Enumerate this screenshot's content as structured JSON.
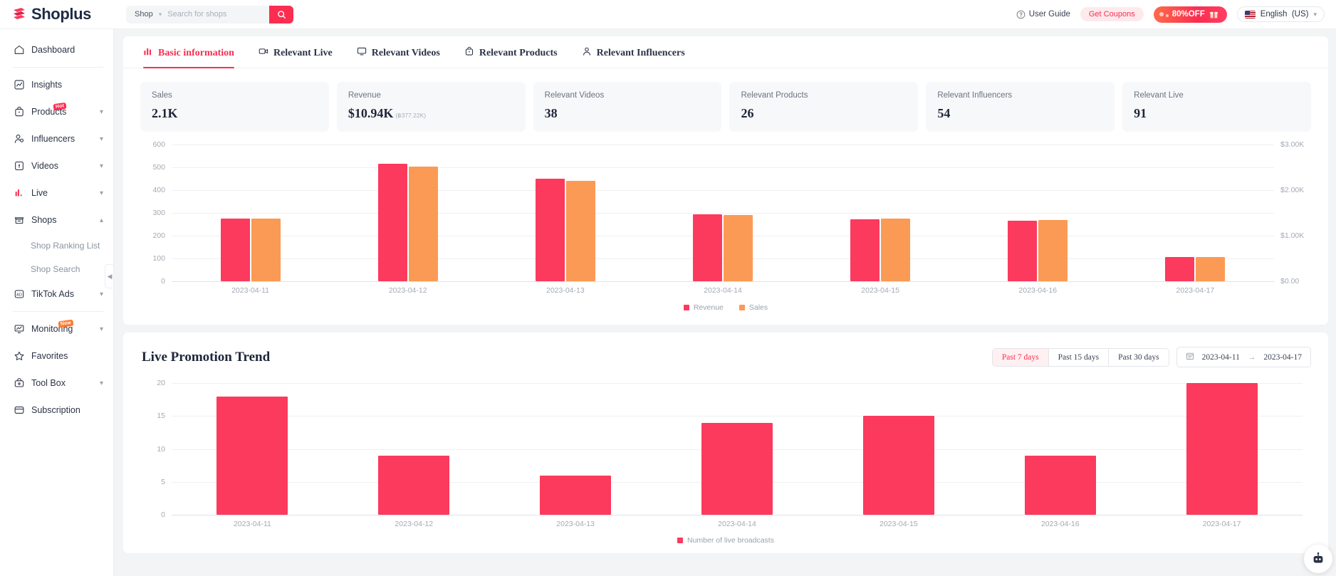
{
  "app": {
    "brand": "Shoplus"
  },
  "search": {
    "scope": "Shop",
    "placeholder": "Search for shops",
    "value": ""
  },
  "header": {
    "user_guide": "User Guide",
    "get_coupons": "Get Coupons",
    "promo": "80%OFF",
    "language": "English  (US)"
  },
  "sidebar": {
    "items": [
      {
        "label": "Dashboard",
        "icon": "home-icon",
        "expandable": false,
        "badge": ""
      },
      {
        "label": "Insights",
        "icon": "insights-icon",
        "expandable": false,
        "badge": ""
      },
      {
        "label": "Products",
        "icon": "products-icon",
        "expandable": true,
        "badge": "Hot"
      },
      {
        "label": "Influencers",
        "icon": "influencers-icon",
        "expandable": true,
        "badge": ""
      },
      {
        "label": "Videos",
        "icon": "videos-icon",
        "expandable": true,
        "badge": ""
      },
      {
        "label": "Live",
        "icon": "live-icon",
        "expandable": true,
        "badge": ""
      },
      {
        "label": "Shops",
        "icon": "shops-icon",
        "expandable": true,
        "badge": ""
      },
      {
        "label": "TikTok Ads",
        "icon": "ads-icon",
        "expandable": true,
        "badge": ""
      },
      {
        "label": "Monitoring",
        "icon": "monitoring-icon",
        "expandable": true,
        "badge": "New"
      },
      {
        "label": "Favorites",
        "icon": "star-icon",
        "expandable": false,
        "badge": ""
      },
      {
        "label": "Tool Box",
        "icon": "toolbox-icon",
        "expandable": true,
        "badge": ""
      },
      {
        "label": "Subscription",
        "icon": "subscription-icon",
        "expandable": false,
        "badge": ""
      }
    ],
    "shops_children": [
      "Shop Ranking List",
      "Shop Search"
    ]
  },
  "tabs": [
    {
      "label": "Basic information",
      "icon": "bar-chart-icon",
      "active": true
    },
    {
      "label": "Relevant Live",
      "icon": "video-camera-icon",
      "active": false
    },
    {
      "label": "Relevant Videos",
      "icon": "monitor-icon",
      "active": false
    },
    {
      "label": "Relevant Products",
      "icon": "bag-icon",
      "active": false
    },
    {
      "label": "Relevant Influencers",
      "icon": "person-icon",
      "active": false
    }
  ],
  "stats": [
    {
      "label": "Sales",
      "value": "2.1K",
      "sub": ""
    },
    {
      "label": "Revenue",
      "value": "$10.94K",
      "sub": "(฿377.22K)"
    },
    {
      "label": "Relevant Videos",
      "value": "38",
      "sub": ""
    },
    {
      "label": "Relevant Products",
      "value": "26",
      "sub": ""
    },
    {
      "label": "Relevant Influencers",
      "value": "54",
      "sub": ""
    },
    {
      "label": "Relevant Live",
      "value": "91",
      "sub": ""
    }
  ],
  "section2": {
    "title": "Live Promotion Trend",
    "ranges": [
      {
        "label": "Past 7 days",
        "active": true
      },
      {
        "label": "Past 15 days",
        "active": false
      },
      {
        "label": "Past 30 days",
        "active": false
      }
    ],
    "date_start": "2023-04-11",
    "date_end": "2023-04-17",
    "date_sep": "→"
  },
  "chart_data": [
    {
      "type": "bar",
      "title": "",
      "categories": [
        "2023-04-11",
        "2023-04-12",
        "2023-04-13",
        "2023-04-14",
        "2023-04-15",
        "2023-04-16",
        "2023-04-17"
      ],
      "series": [
        {
          "name": "Revenue",
          "color": "#fb3a5d",
          "axis": "left",
          "values": [
            275,
            517,
            450,
            295,
            272,
            267,
            105
          ]
        },
        {
          "name": "Sales",
          "color": "#fb9a55",
          "axis": "right",
          "values": [
            1370,
            2520,
            2210,
            1450,
            1370,
            1340,
            530
          ]
        }
      ],
      "left_ticks": [
        "0",
        "100",
        "200",
        "300",
        "400",
        "500",
        "600"
      ],
      "left_lim": [
        0,
        600
      ],
      "right_ticks": [
        "$0.00",
        "",
        "$1.00K",
        "",
        "$2.00K",
        "",
        "$3.00K"
      ],
      "right_lim": [
        0,
        3000
      ],
      "grid": true,
      "legend": [
        "Revenue",
        "Sales"
      ],
      "legend_position": "bottom"
    },
    {
      "type": "bar",
      "title": "Live Promotion Trend",
      "categories": [
        "2023-04-11",
        "2023-04-12",
        "2023-04-13",
        "2023-04-14",
        "2023-04-15",
        "2023-04-16",
        "2023-04-17"
      ],
      "values": [
        18,
        9,
        6,
        14,
        15,
        9,
        20
      ],
      "color": "#fb3a5d",
      "ylabel": "",
      "xlabel": "",
      "ticks": [
        "0",
        "5",
        "10",
        "15",
        "20"
      ],
      "ylim": [
        0,
        20
      ],
      "grid": true,
      "legend": [
        "Number of live broadcasts"
      ],
      "legend_position": "bottom"
    }
  ]
}
